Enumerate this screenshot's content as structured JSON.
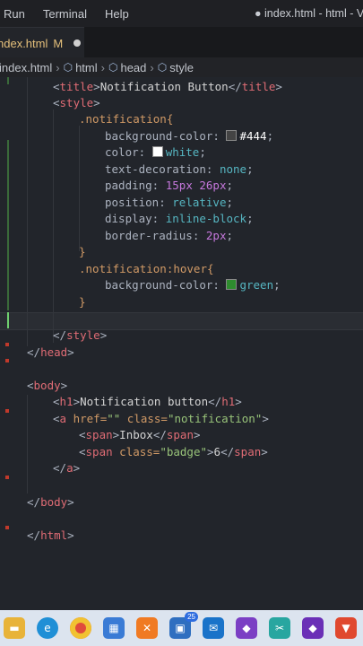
{
  "menu": {
    "items": [
      "Run",
      "Terminal",
      "Help"
    ],
    "window_title": "● index.html - html - Vi"
  },
  "tab": {
    "name": "ndex.html",
    "modified": "M"
  },
  "breadcrumb": {
    "items": [
      "index.html",
      "html",
      "head",
      "style"
    ]
  },
  "code": {
    "l1": {
      "a": "<",
      "b": "title",
      ">": ">",
      "t": "Notification Button",
      "c": "</",
      "d": "title",
      "e": ">"
    },
    "l2": {
      "a": "<",
      "b": "style",
      "e": ">"
    },
    "l3": {
      "s": ".notification{"
    },
    "l4": {
      "p": "background-color:",
      "v": "#444",
      "z": ";"
    },
    "l5": {
      "p": "color:",
      "v": "white",
      "z": ";"
    },
    "l6": {
      "p": "text-decoration:",
      "v": "none",
      "z": ";"
    },
    "l7": {
      "p": "padding:",
      "v": "15px 26px",
      "z": ";"
    },
    "l8": {
      "p": "position:",
      "v": "relative",
      "z": ";"
    },
    "l9": {
      "p": "display:",
      "v": "inline-block",
      "z": ";"
    },
    "l10": {
      "p": "border-radius:",
      "v": "2px",
      "z": ";"
    },
    "l11": {
      "s": "}"
    },
    "l12": {
      "s": ".notification:hover{"
    },
    "l13": {
      "p": "background-color:",
      "v": "green",
      "z": ";"
    },
    "l14": {
      "s": "}"
    },
    "l16": {
      "a": "</",
      "b": "style",
      "e": ">"
    },
    "l17": {
      "a": "</",
      "b": "head",
      "e": ">"
    },
    "l19": {
      "a": "<",
      "b": "body",
      "e": ">"
    },
    "l20": {
      "a": "<",
      "b": "h1",
      ">": ">",
      "t": "Notification button",
      "c": "</",
      "d": "h1",
      "e": ">"
    },
    "l21": {
      "a": "<",
      "b": "a",
      "at": " href=",
      "s1": "\"\"",
      "at2": " class=",
      "s2": "\"notification\"",
      "e": ">"
    },
    "l22": {
      "a": "<",
      "b": "span",
      ">": ">",
      "t": "Inbox",
      "c": "</",
      "d": "span",
      "e": ">"
    },
    "l23": {
      "a": "<",
      "b": "span",
      "at": " class=",
      "s1": "\"badge\"",
      ">": ">",
      "t": "6",
      "c": "</",
      "d": "span",
      "e": ">"
    },
    "l24": {
      "a": "</",
      "b": "a",
      "e": ">"
    },
    "l26": {
      "a": "</",
      "b": "body",
      "e": ">"
    },
    "l28": {
      "a": "</",
      "b": "html",
      "e": ">"
    }
  },
  "colors": {
    "swatch_444": "#444444",
    "swatch_white": "#ffffff",
    "swatch_green": "#2e8b2e"
  },
  "taskbar": {
    "icons": [
      "file-explorer-icon",
      "edge-icon",
      "chrome-icon",
      "store-icon",
      "xampp-icon",
      "teams-icon",
      "mail-icon",
      "visual-studio-icon",
      "snip-icon",
      "vs-purple-icon",
      "brave-icon"
    ],
    "notif_count": "25"
  }
}
